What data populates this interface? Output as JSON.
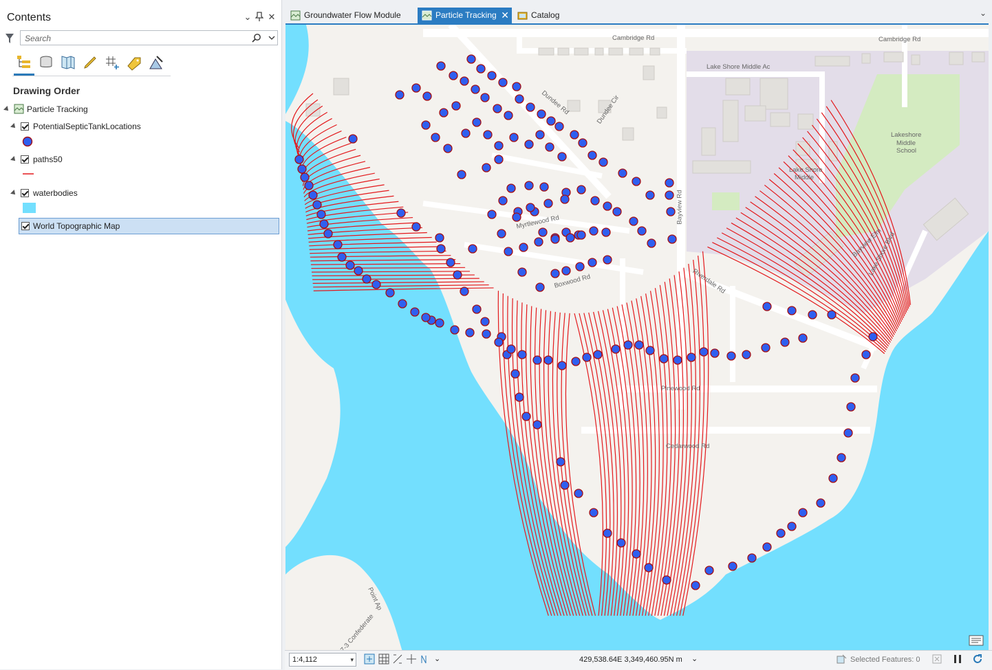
{
  "contents": {
    "title": "Contents",
    "search_placeholder": "Search",
    "drawing_order_label": "Drawing Order",
    "map_name": "Particle Tracking",
    "layers": [
      {
        "name": "PotentialSepticTankLocations",
        "checked": true,
        "symbol": "blue-point"
      },
      {
        "name": "paths50",
        "checked": true,
        "symbol": "red-line"
      },
      {
        "name": "waterbodies",
        "checked": true,
        "symbol": "cyan-polygon"
      },
      {
        "name": "World Topographic Map",
        "checked": true,
        "selected": true
      }
    ]
  },
  "tabs": [
    {
      "label": "Groundwater Flow Module",
      "icon": "map-icon",
      "active": false
    },
    {
      "label": "Particle Tracking",
      "icon": "map-icon",
      "active": true
    },
    {
      "label": "Catalog",
      "icon": "catalog-icon",
      "active": false
    }
  ],
  "map_labels": {
    "cambridge_rd_1": "Cambridge Rd",
    "cambridge_rd_2": "Cambridge Rd",
    "lake_shore_middle_ac": "Lake Shore Middle Ac",
    "lakeshore_middle_school_1": "Lakeshore",
    "lakeshore_middle_school_2": "Middle",
    "lakeshore_middle_school_3": "School",
    "lake_shore_middle_1": "Lake Shore",
    "lake_shore_middle_2": "Middle",
    "dundee_rd": "Dundee Rd",
    "dundee_cir": "Dundee Cir",
    "bayview_rd": "Bayview Rd",
    "riverdale_rd": "Riverdale Rd",
    "pinewood_rd": "Pinewood Rd",
    "cedarwood_rd": "Cedarwood Rd",
    "boxwood_rd": "Boxwood Rd",
    "myrtlewood_rd": "Myrtlewood Rd",
    "bayview_elm": "Bayview Elm",
    "lake_shore_blvd": "Lake Shore Blvd",
    "point_ap": "Point Ap",
    "confederate": "7-3 Confederate"
  },
  "statusbar": {
    "scale": "1:4,112",
    "coordinates": "429,538.64E 3,349,460.95N m",
    "selected_features": "Selected Features: 0"
  },
  "colors": {
    "water": "#73dffe",
    "paths": "#e3191c",
    "points_fill": "#2f5ff0",
    "points_stroke": "#a40f14",
    "accent": "#2b7cc2",
    "school": "#e3dde9",
    "park": "#d4ebc1"
  }
}
